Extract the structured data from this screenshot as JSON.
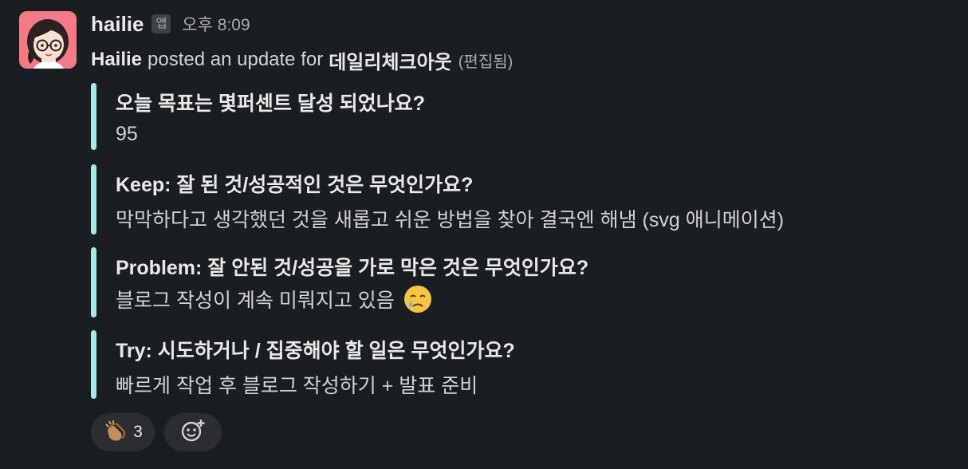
{
  "message": {
    "username": "hailie",
    "app_badge": "앱",
    "timestamp": "오후 8:09",
    "author": "Hailie",
    "posted_text": "posted an update for",
    "channel": "데일리체크아웃",
    "edited": "(편집됨)"
  },
  "blocks": [
    {
      "question": "오늘 목표는 몇퍼센트 달성 되었나요?",
      "answer": "95"
    },
    {
      "question": "Keep: 잘 된 것/성공적인 것은 무엇인가요?",
      "answer": "막막하다고 생각했던 것을 새롭고 쉬운 방법을 찾아 결국엔 해냄 (svg 애니메이션)"
    },
    {
      "question": "Problem: 잘 안된 것/성공을 가로 막은 것은 무엇인가요?",
      "answer": "블로그 작성이 계속 미뤄지고 있음",
      "answer_emoji": "crying-face-icon"
    },
    {
      "question": "Try: 시도하거나 / 집중해야 할 일은 무엇인가요?",
      "answer": "빠르게 작업 후 블로그 작성하기 + 발표 준비"
    }
  ],
  "reactions": [
    {
      "emoji": "clapping-hands-icon",
      "count": "3"
    },
    {
      "emoji": "add-reaction-icon"
    }
  ],
  "colors": {
    "background": "#1a1d21",
    "quote_bar": "#a8e8ea",
    "avatar_bg": "#f47a86",
    "reaction_bg": "#2c2d30"
  }
}
